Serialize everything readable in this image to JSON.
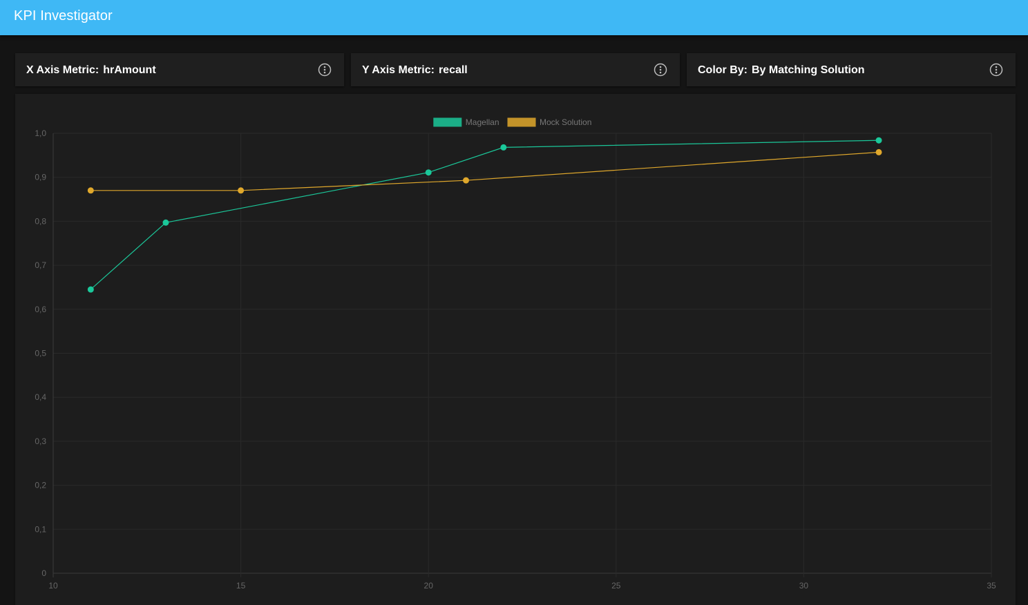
{
  "app": {
    "title": "KPI Investigator"
  },
  "selectors": [
    {
      "label": "X Axis Metric:",
      "value": "hrAmount",
      "icon": "more-vert-icon"
    },
    {
      "label": "Y Axis Metric:",
      "value": "recall",
      "icon": "more-vert-icon"
    },
    {
      "label": "Color By:",
      "value": "By Matching Solution",
      "icon": "more-vert-icon"
    }
  ],
  "colors": {
    "appbar": "#3fb8f5",
    "magellan": "#1bc89a",
    "mock": "#e0a82c"
  },
  "chart_data": {
    "type": "line",
    "xlim": [
      10,
      35
    ],
    "ylim": [
      0,
      1.0
    ],
    "xticks": [
      "10",
      "15",
      "20",
      "25",
      "30",
      "35"
    ],
    "yticks": [
      "0",
      "0,1",
      "0,2",
      "0,3",
      "0,4",
      "0,5",
      "0,6",
      "0,7",
      "0,8",
      "0,9",
      "1,0"
    ],
    "grid": true,
    "legend": "top-center",
    "series": [
      {
        "name": "Magellan",
        "color": "#1bc89a",
        "points": [
          [
            11,
            0.645
          ],
          [
            13,
            0.797
          ],
          [
            20,
            0.911
          ],
          [
            22,
            0.968
          ],
          [
            32,
            0.984
          ]
        ]
      },
      {
        "name": "Mock Solution",
        "color": "#e0a82c",
        "points": [
          [
            11,
            0.87
          ],
          [
            15,
            0.87
          ],
          [
            21,
            0.893
          ],
          [
            32,
            0.957
          ]
        ]
      }
    ]
  }
}
